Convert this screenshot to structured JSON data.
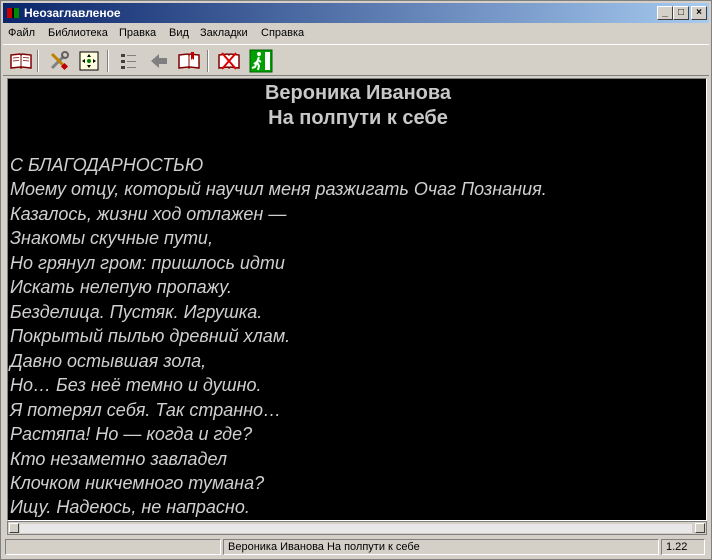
{
  "window": {
    "title": "Неозаглавленое"
  },
  "menu": [
    "Файл",
    "Библиотека",
    "Правка",
    "Вид",
    "Закладки",
    "Справка"
  ],
  "toolbar": {
    "icons": [
      "open-book-icon",
      "tools-icon",
      "focus-icon",
      "list-icon",
      "back-arrow-icon",
      "bookmark-book-icon",
      "close-book-icon",
      "exit-icon"
    ]
  },
  "book": {
    "author": "Вероника Иванова",
    "title": "На полпути к себе",
    "lines": [
      "С БЛАГОДАРНОСТЬЮ",
      "Моему отцу, который научил меня разжигать Очаг Познания.",
      "Казалось, жизни ход отлажен —",
      "Знакомы скучные пути,",
      "Но грянул гром: пришлось идти",
      "Искать нелепую пропажу.",
      "Безделица. Пустяк. Игрушка.",
      "Покрытый пылью древний хлам.",
      "Давно остывшая зола,",
      "Но… Без неё темно и душно.",
      "Я потерял себя. Так странно…",
      "Растяпа! Но — когда и где?",
      "Кто незаметно завладел",
      "Клочком никчемного тумана?",
      "Ищу. Надеюсь, не напрасно."
    ]
  },
  "status": {
    "left": "",
    "center": "Вероника Иванова На полпути к себе",
    "version": "1.22"
  }
}
